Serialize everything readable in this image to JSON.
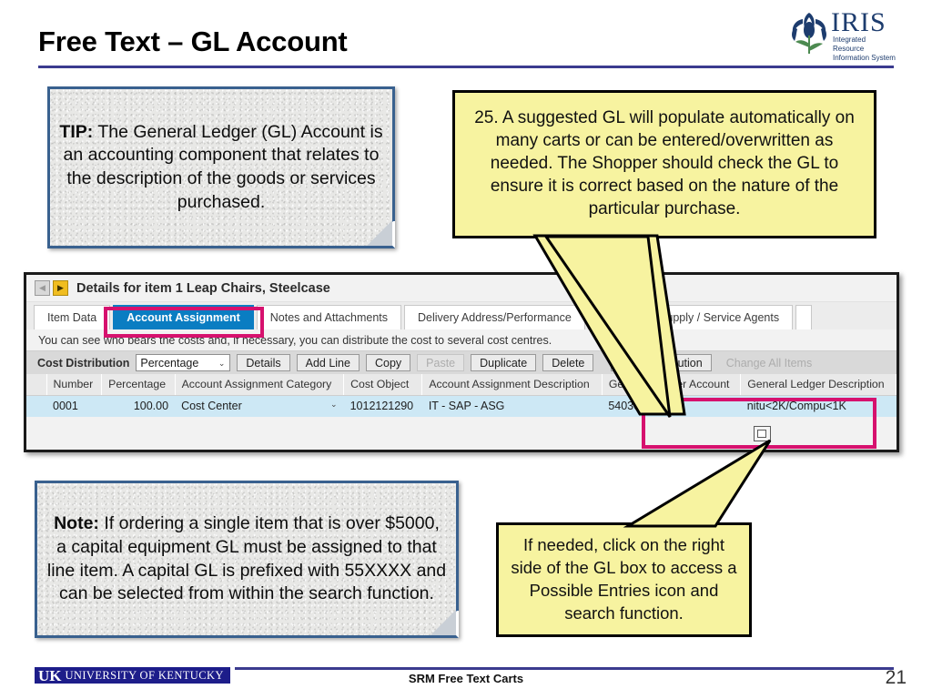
{
  "slide": {
    "title": "Free Text – GL Account",
    "accent_rule_color": "#3b3b8f"
  },
  "logo": {
    "name": "IRIS",
    "tagline_line1": "Integrated Resource",
    "tagline_line2": "Information System",
    "color": "#1d3c6e"
  },
  "tip_box": {
    "lead": "TIP:",
    "text": " The General Ledger (GL) Account is an accounting component that relates to the description of the goods or services purchased.",
    "border_color": "#39618f"
  },
  "note_box": {
    "lead": "Note:",
    "text": " If ordering a single item that is over $5000, a capital equipment GL must be assigned to that line item. A capital GL is prefixed with 55XXXX and can be selected from within the search function.",
    "border_color": "#39618f"
  },
  "callouts": {
    "step25": {
      "text": "25. A suggested GL will populate automatically on many carts or can be entered/overwritten as needed. The Shopper should check the GL to ensure it is correct based on the nature of the particular purchase.",
      "fill": "#f7f3a0"
    },
    "gl_box_hint": {
      "text": "If needed, click on the right side of the GL box to access a Possible Entries icon and search function.",
      "fill": "#f7f3a0"
    }
  },
  "sap": {
    "detail_header": {
      "prev_icon": "◀",
      "next_icon": "▶",
      "title": "Details for item 1  Leap Chairs, Steelcase"
    },
    "tabs": [
      {
        "label": "Item Data",
        "active": false
      },
      {
        "label": "Account Assignment",
        "active": true
      },
      {
        "label": "Notes and Attachments",
        "active": false
      },
      {
        "label": "Delivery Address/Performance",
        "active": false
      },
      {
        "label": "Sources of Supply / Service Agents",
        "active": false
      },
      {
        "label": "",
        "active": false
      }
    ],
    "info_line": "You can see who bears the costs and, if necessary, you can distribute the cost to several cost centres.",
    "toolbar": {
      "label": "Cost Distribution",
      "select_value": "Percentage",
      "caret_icon": "⌄",
      "buttons": [
        {
          "label": "Details",
          "disabled": false
        },
        {
          "label": "Add Line",
          "disabled": false
        },
        {
          "label": "Copy",
          "disabled": false
        },
        {
          "label": "Paste",
          "disabled": true
        },
        {
          "label": "Duplicate",
          "disabled": false
        },
        {
          "label": "Delete",
          "disabled": false
        },
        {
          "label": "Split Distribution",
          "disabled": false
        },
        {
          "label": "Change All Items",
          "disabled": true
        }
      ]
    },
    "table": {
      "columns": [
        "Number",
        "Percentage",
        "Account Assignment Category",
        "Cost Object",
        "Account Assignment Description",
        "General Ledger Account",
        "General Ledger Description"
      ],
      "rows": [
        {
          "number": "0001",
          "percentage": "100.00",
          "category": "Cost Center",
          "cost_object": "1012121290",
          "assignment_description": "IT - SAP - ASG",
          "gl_account": "540300",
          "gl_description": "nitu<2K/Compu<1K"
        }
      ]
    },
    "highlight_color": "#d6116e",
    "possible_entries_icon": "possible-entries-icon"
  },
  "footer": {
    "uk_mark": "UK",
    "university": "UNIVERSITY OF KENTUCKY",
    "center_text": "SRM Free Text Carts",
    "page_number": "21"
  }
}
